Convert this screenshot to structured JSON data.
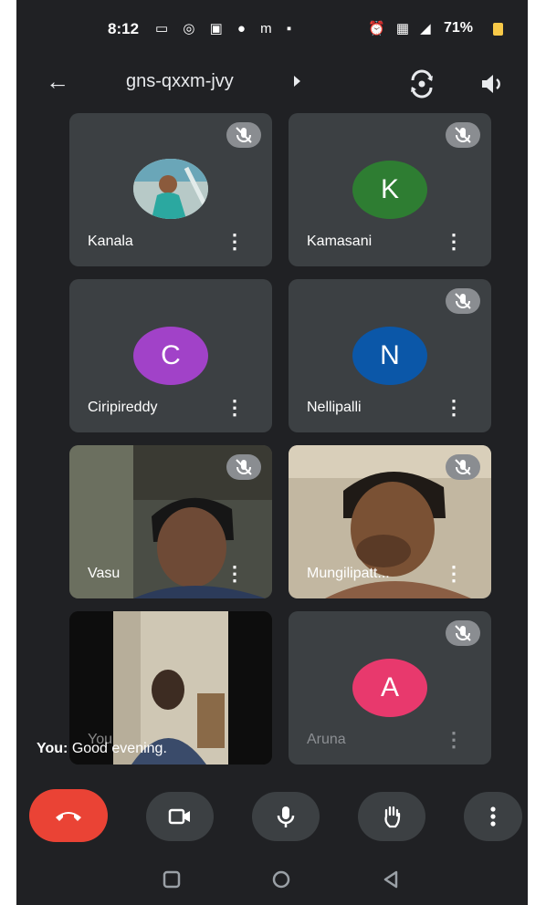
{
  "status": {
    "time": "8:12",
    "battery": "71%"
  },
  "header": {
    "meeting_code": "gns-qxxm-jvy"
  },
  "participants": [
    {
      "name": "Kanala"
    },
    {
      "name": "Kamasani",
      "initial": "K",
      "color": "#2e7d32"
    },
    {
      "name": "Ciripireddy",
      "initial": "C",
      "color": "#a142c8"
    },
    {
      "name": "Nellipalli",
      "initial": "N",
      "color": "#0b57a8"
    },
    {
      "name": "Vasu"
    },
    {
      "name": "Mungilipatt..."
    },
    {
      "name": "You"
    },
    {
      "name": "Aruna",
      "initial": "A",
      "color": "#e8396d"
    }
  ],
  "caption": {
    "speaker": "You:",
    "text": "Good evening."
  }
}
